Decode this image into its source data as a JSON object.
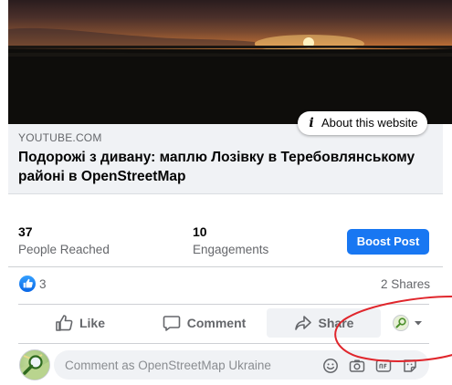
{
  "link_preview": {
    "about_label": "About this website",
    "domain": "YOUTUBE.COM",
    "title": "Подорожі з дивану: маплю Лозівку в Теребовлянському районі в OpenStreetMap"
  },
  "stats": {
    "reached_count": "37",
    "reached_label": "People Reached",
    "engagements_count": "10",
    "engagements_label": "Engagements",
    "boost_label": "Boost Post"
  },
  "reactions": {
    "like_count": "3",
    "shares_label": "2 Shares"
  },
  "actions": {
    "like_label": "Like",
    "comment_label": "Comment",
    "share_label": "Share"
  },
  "comment": {
    "placeholder": "Comment as OpenStreetMap Ukraine"
  },
  "colors": {
    "accent": "#1877f2",
    "annotation": "#e0262c"
  }
}
